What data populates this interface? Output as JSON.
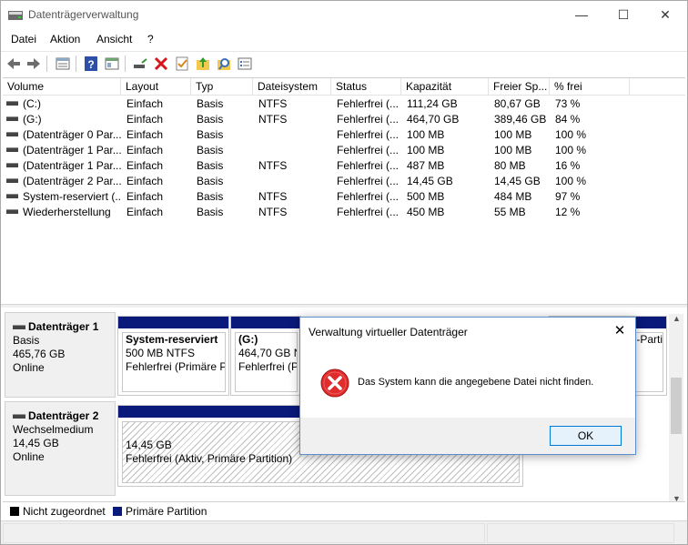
{
  "window": {
    "title": "Datenträgerverwaltung",
    "controls": {
      "minimize": "—",
      "maximize": "☐",
      "close": "✕"
    }
  },
  "menu": [
    "Datei",
    "Aktion",
    "Ansicht",
    "?"
  ],
  "toolbar": {
    "icons": [
      "back-arrow-icon",
      "forward-arrow-icon",
      "list-view-icon",
      "help-icon",
      "properties-icon",
      "connect-icon",
      "delete-icon",
      "check-icon",
      "up-folder-icon",
      "search-icon",
      "list-icon"
    ]
  },
  "table": {
    "columns": [
      "Volume",
      "Layout",
      "Typ",
      "Dateisystem",
      "Status",
      "Kapazität",
      "Freier Sp...",
      "% frei"
    ],
    "rows": [
      [
        "(C:)",
        "Einfach",
        "Basis",
        "NTFS",
        "Fehlerfrei (...",
        "111,24 GB",
        "80,67 GB",
        "73 %"
      ],
      [
        "(G:)",
        "Einfach",
        "Basis",
        "NTFS",
        "Fehlerfrei (...",
        "464,70 GB",
        "389,46 GB",
        "84 %"
      ],
      [
        "(Datenträger 0 Par...",
        "Einfach",
        "Basis",
        "",
        "Fehlerfrei (...",
        "100 MB",
        "100 MB",
        "100 %"
      ],
      [
        "(Datenträger 1 Par...",
        "Einfach",
        "Basis",
        "",
        "Fehlerfrei (...",
        "100 MB",
        "100 MB",
        "100 %"
      ],
      [
        "(Datenträger 1 Par...",
        "Einfach",
        "Basis",
        "NTFS",
        "Fehlerfrei (...",
        "487 MB",
        "80 MB",
        "16 %"
      ],
      [
        "(Datenträger 2 Par...",
        "Einfach",
        "Basis",
        "",
        "Fehlerfrei (...",
        "14,45 GB",
        "14,45 GB",
        "100 %"
      ],
      [
        "System-reserviert (...",
        "Einfach",
        "Basis",
        "NTFS",
        "Fehlerfrei (...",
        "500 MB",
        "484 MB",
        "97 %"
      ],
      [
        "Wiederherstellung",
        "Einfach",
        "Basis",
        "NTFS",
        "Fehlerfrei (...",
        "450 MB",
        "55 MB",
        "12 %"
      ]
    ]
  },
  "disks": [
    {
      "name": "Datenträger 1",
      "type": "Basis",
      "size": "465,76 GB",
      "state": "Online",
      "partitions": [
        {
          "name": "System-reserviert",
          "detail": "500 MB NTFS",
          "status": "Fehlerfrei (Primäre P"
        },
        {
          "name": "(G:)",
          "detail": "464,70 GB NT",
          "status": "Fehlerfrei (Pri"
        },
        {
          "name": "",
          "detail": "",
          "status": "-Parti"
        }
      ]
    },
    {
      "name": "Datenträger 2",
      "type": "Wechselmedium",
      "size": "14,45 GB",
      "state": "Online",
      "partitions": [
        {
          "name": "",
          "detail": "14,45 GB",
          "status": "Fehlerfrei (Aktiv, Primäre Partition)"
        }
      ]
    }
  ],
  "legend": [
    {
      "label": "Nicht zugeordnet",
      "color": "#000000"
    },
    {
      "label": "Primäre Partition",
      "color": "#0a1a7a"
    }
  ],
  "dialog": {
    "title": "Verwaltung virtueller Datenträger",
    "message": "Das System kann die angegebene Datei nicht finden.",
    "ok_label": "OK",
    "close": "✕",
    "icon": "error-icon"
  }
}
